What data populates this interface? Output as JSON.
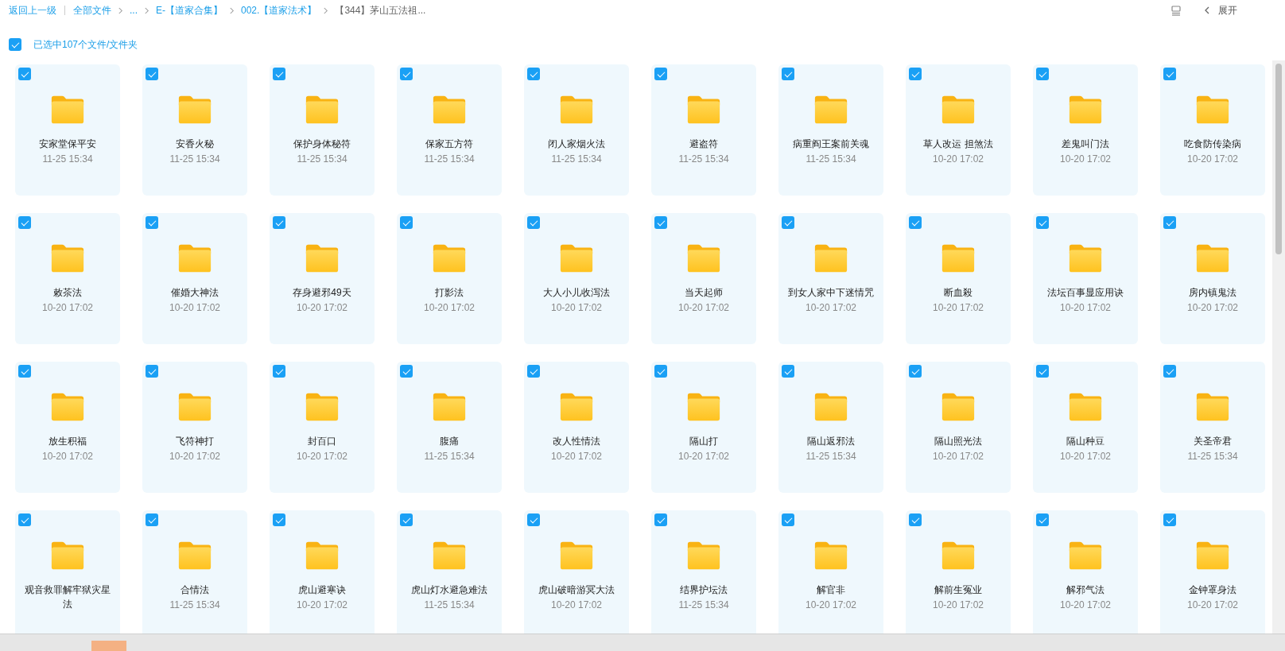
{
  "breadcrumb": {
    "back": "返回上一级",
    "items": [
      {
        "label": "全部文件"
      },
      {
        "label": "..."
      },
      {
        "label": "E-【道家合集】"
      },
      {
        "label": "002.【道家法术】"
      },
      {
        "label": "【344】茅山五法祖..."
      }
    ]
  },
  "toolbar": {
    "expand": "展开"
  },
  "selection": {
    "checked": true,
    "label": "已选中107个文件/文件夹"
  },
  "folders": [
    {
      "name": "安家堂保平安",
      "date": "11-25 15:34",
      "checked": true
    },
    {
      "name": "安香火秘",
      "date": "11-25 15:34",
      "checked": true
    },
    {
      "name": "保护身体秘符",
      "date": "11-25 15:34",
      "checked": true
    },
    {
      "name": "保家五方符",
      "date": "11-25 15:34",
      "checked": true
    },
    {
      "name": "闭人家烟火法",
      "date": "11-25 15:34",
      "checked": true
    },
    {
      "name": "避盗符",
      "date": "11-25 15:34",
      "checked": true
    },
    {
      "name": "病重阎王案前关魂",
      "date": "11-25 15:34",
      "checked": true
    },
    {
      "name": "草人改运 担煞法",
      "date": "10-20 17:02",
      "checked": true
    },
    {
      "name": "差鬼叫门法",
      "date": "10-20 17:02",
      "checked": true
    },
    {
      "name": "吃食防传染病",
      "date": "10-20 17:02",
      "checked": true
    },
    {
      "name": "敕茶法",
      "date": "10-20 17:02",
      "checked": true
    },
    {
      "name": "催婚大神法",
      "date": "10-20 17:02",
      "checked": true
    },
    {
      "name": "存身避邪49天",
      "date": "10-20 17:02",
      "checked": true
    },
    {
      "name": "打影法",
      "date": "10-20 17:02",
      "checked": true
    },
    {
      "name": "大人小儿收泻法",
      "date": "10-20 17:02",
      "checked": true
    },
    {
      "name": "当天起师",
      "date": "10-20 17:02",
      "checked": true
    },
    {
      "name": "到女人家中下迷情咒",
      "date": "10-20 17:02",
      "checked": true
    },
    {
      "name": "断血殺",
      "date": "10-20 17:02",
      "checked": true
    },
    {
      "name": "法坛百事显应用诀",
      "date": "10-20 17:02",
      "checked": true
    },
    {
      "name": "房内镇鬼法",
      "date": "10-20 17:02",
      "checked": true
    },
    {
      "name": "放生积福",
      "date": "10-20 17:02",
      "checked": true
    },
    {
      "name": "飞符神打",
      "date": "10-20 17:02",
      "checked": true
    },
    {
      "name": "封百口",
      "date": "10-20 17:02",
      "checked": true
    },
    {
      "name": "腹痛",
      "date": "11-25 15:34",
      "checked": true
    },
    {
      "name": "改人性情法",
      "date": "10-20 17:02",
      "checked": true
    },
    {
      "name": "隔山打",
      "date": "10-20 17:02",
      "checked": true
    },
    {
      "name": "隔山返邪法",
      "date": "11-25 15:34",
      "checked": true
    },
    {
      "name": "隔山照光法",
      "date": "10-20 17:02",
      "checked": true
    },
    {
      "name": "隔山种豆",
      "date": "10-20 17:02",
      "checked": true
    },
    {
      "name": "关圣帝君",
      "date": "11-25 15:34",
      "checked": true
    },
    {
      "name": "观音救罪解牢狱灾星法",
      "checked": true
    },
    {
      "name": "合情法",
      "date": "11-25 15:34",
      "checked": true
    },
    {
      "name": "虎山避寒诀",
      "date": "10-20 17:02",
      "checked": true
    },
    {
      "name": "虎山灯水避急难法",
      "date": "11-25 15:34",
      "checked": true
    },
    {
      "name": "虎山破暗游冥大法",
      "date": "10-20 17:02",
      "checked": true
    },
    {
      "name": "结界护坛法",
      "date": "11-25 15:34",
      "checked": true
    },
    {
      "name": "解官非",
      "date": "10-20 17:02",
      "checked": true
    },
    {
      "name": "解前生冤业",
      "date": "10-20 17:02",
      "checked": true
    },
    {
      "name": "解邪气法",
      "date": "10-20 17:02",
      "checked": true
    },
    {
      "name": "金钟罩身法",
      "date": "10-20 17:02",
      "checked": true
    }
  ]
}
